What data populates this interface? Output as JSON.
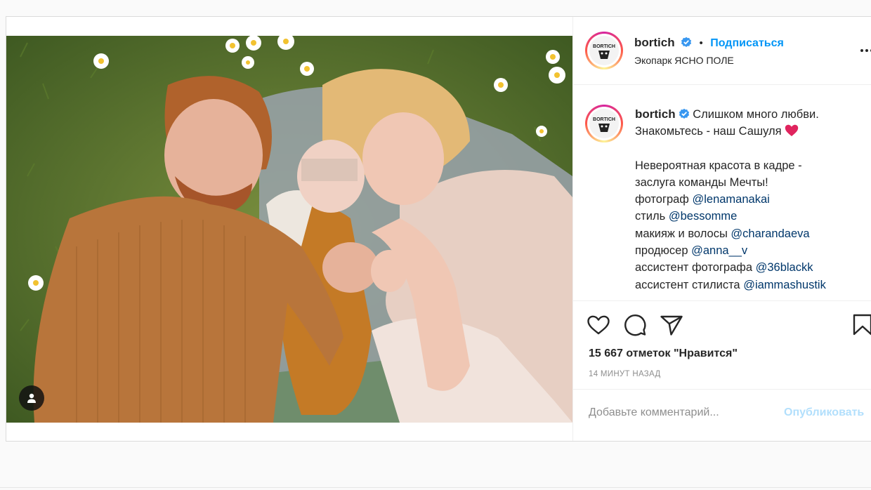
{
  "post": {
    "username": "bortich",
    "dot": "•",
    "follow_label": "Подписаться",
    "location": "Экопарк ЯСНО ПОЛЕ",
    "avatar_logo_text": "BORTICH",
    "caption": {
      "line1": "Слишком много любви.",
      "line2": "Знакомьтесь - наш Сашуля",
      "line3": "Невероятная красота в кадре -",
      "line4": "заслуга команды Мечты!",
      "credits": [
        {
          "role": "фотограф",
          "handle": "@lenamanakai"
        },
        {
          "role": "стиль",
          "handle": "@bessomme"
        },
        {
          "role": "макияж и волосы",
          "handle": "@charandaeva"
        },
        {
          "role": "продюсер",
          "handle": "@anna__v"
        },
        {
          "role": "ассистент фотографа",
          "handle": "@36blackk"
        },
        {
          "role": "ассистент стилиста",
          "handle": "@iammashustik"
        }
      ]
    },
    "likes_text": "15 667 отметок \"Нравится\"",
    "time_ago": "14 МИНУТ НАЗАД",
    "comment_placeholder": "Добавьте комментарий...",
    "publish_label": "Опубликовать",
    "icons": [
      "verified-badge-icon",
      "more-options-icon",
      "heart-icon",
      "comment-icon",
      "share-icon",
      "bookmark-icon",
      "user-tag-icon",
      "heart-emoji-icon"
    ],
    "colors": {
      "accent": "#0095f6",
      "verified": "#3897f0",
      "heart_emoji": "#e0245e",
      "publish_disabled": "#b2dffc"
    }
  }
}
